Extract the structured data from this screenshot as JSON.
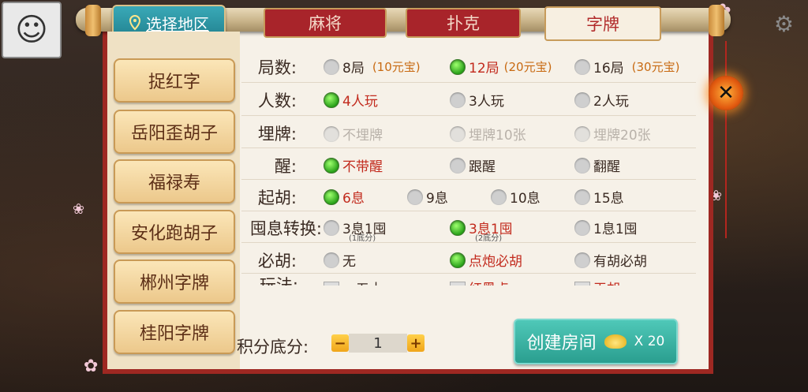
{
  "header": {
    "region_button": "选择地区",
    "tabs": [
      {
        "label": "麻将",
        "active": false
      },
      {
        "label": "扑克",
        "active": false
      },
      {
        "label": "字牌",
        "active": true
      }
    ]
  },
  "games": [
    "捉红字",
    "岳阳歪胡子",
    "福禄寿",
    "安化跑胡子",
    "郴州字牌",
    "桂阳字牌"
  ],
  "rules": {
    "rounds": {
      "label": "局数:",
      "options": [
        {
          "text": "8局",
          "price": "(10元宝)"
        },
        {
          "text": "12局",
          "price": "(20元宝)"
        },
        {
          "text": "16局",
          "price": "(30元宝)"
        }
      ]
    },
    "players": {
      "label": "人数:",
      "options": [
        "4人玩",
        "3人玩",
        "2人玩"
      ]
    },
    "bury": {
      "label": "埋牌:",
      "options": [
        "不埋牌",
        "埋牌10张",
        "埋牌20张"
      ]
    },
    "xing": {
      "label": "醒:",
      "options": [
        "不带醒",
        "跟醒",
        "翻醒"
      ]
    },
    "hu": {
      "label": "起胡:",
      "options": [
        "6息",
        "9息",
        "10息",
        "15息"
      ]
    },
    "convert": {
      "label": "囤息转换:",
      "options": [
        "3息1囤",
        "3息1囤",
        "1息1囤"
      ],
      "subs": [
        "(1底分)",
        "(2底分)"
      ]
    },
    "bihu": {
      "label": "必胡:",
      "options": [
        "无",
        "点炮必胡",
        "有胡必胡"
      ]
    },
    "play": {
      "label": "玩法:",
      "options": [
        "一五十",
        "红黑点",
        "天胡"
      ]
    }
  },
  "footer": {
    "score_label": "积分底分:",
    "score_value": "1",
    "minus": "−",
    "plus": "+",
    "create_label": "创建房间",
    "cost": "X 20"
  },
  "icons": {
    "close": "close-icon",
    "gear": "gear-icon",
    "pin": "location-pin-icon"
  }
}
